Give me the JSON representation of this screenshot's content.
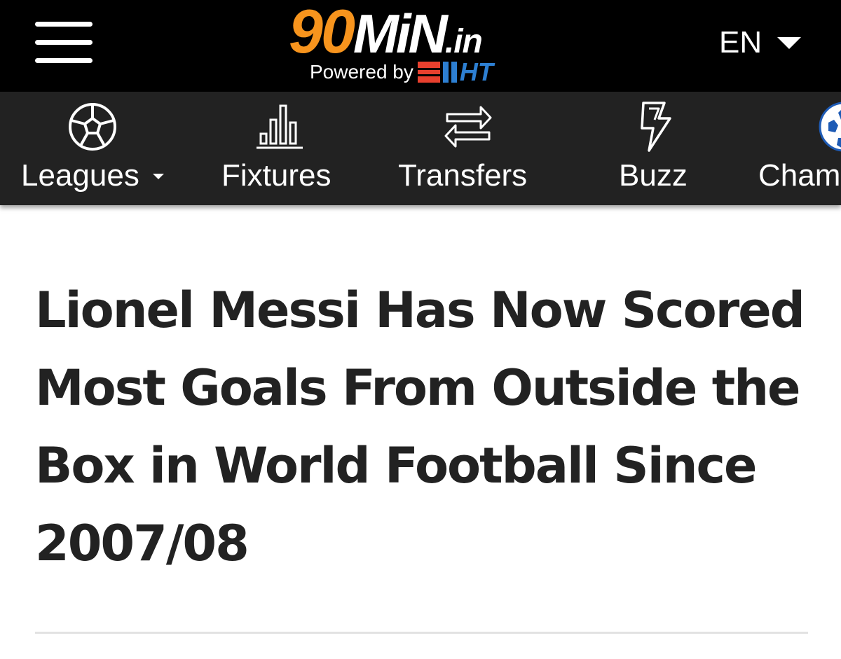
{
  "header": {
    "logo": {
      "number": "90",
      "word": "MiN",
      "tld": ".in",
      "powered_by": "Powered by",
      "partner": "HT"
    },
    "language": "EN",
    "colors": {
      "brand_orange": "#f7941d",
      "ht_red": "#e8402e",
      "ht_blue": "#2d7fd2",
      "header_bg": "#000000",
      "nav_bg": "#222222"
    }
  },
  "nav": {
    "items": [
      {
        "label": "Leagues",
        "icon": "soccer-ball-icon",
        "has_dropdown": true
      },
      {
        "label": "Fixtures",
        "icon": "bar-chart-icon"
      },
      {
        "label": "Transfers",
        "icon": "transfer-arrows-icon"
      },
      {
        "label": "Buzz",
        "icon": "lightning-icon"
      },
      {
        "label": "Cham",
        "icon": "champions-league-ball-icon"
      }
    ]
  },
  "article": {
    "headline": "Lionel Messi Has Now Scored Most Goals From Outside the Box in World Football Since 2007/08"
  }
}
